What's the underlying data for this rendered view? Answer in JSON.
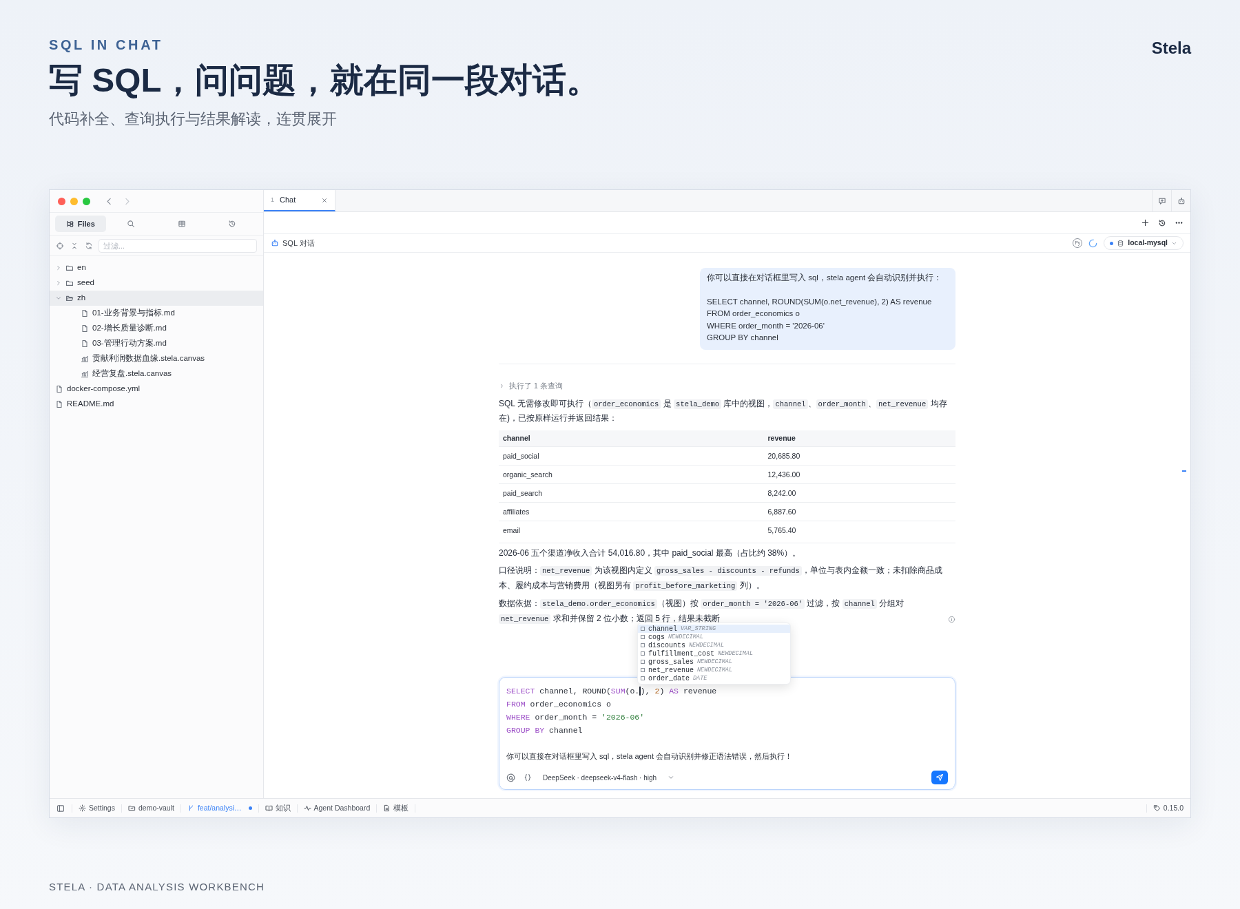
{
  "hero": {
    "eyebrow": "SQL IN CHAT",
    "title": "写 SQL，问问题，就在同一段对话。",
    "subtitle": "代码补全、查询执行与结果解读，连贯展开",
    "brand": "Stela"
  },
  "sidebar": {
    "tabs": [
      {
        "kind": "files",
        "label": "Files",
        "selected": true
      },
      {
        "kind": "search",
        "selected": false
      },
      {
        "kind": "table",
        "selected": false
      },
      {
        "kind": "history",
        "selected": false
      }
    ],
    "filter": {
      "placeholder": "过滤..."
    },
    "tree": [
      {
        "kind": "folder",
        "label": "en",
        "expanded": false,
        "selected": false
      },
      {
        "kind": "folder",
        "label": "seed",
        "expanded": false,
        "selected": false
      },
      {
        "kind": "folder",
        "label": "zh",
        "expanded": true,
        "selected": true,
        "children": [
          {
            "kind": "file",
            "label": "01-业务背景与指标.md",
            "selected": false
          },
          {
            "kind": "file",
            "label": "02-增长质量诊断.md",
            "selected": false
          },
          {
            "kind": "file",
            "label": "03-管理行动方案.md",
            "selected": false
          },
          {
            "kind": "canvas",
            "label": "贡献利润数据血缘.stela.canvas",
            "selected": false
          },
          {
            "kind": "canvas",
            "label": "经营复盘.stela.canvas",
            "selected": false
          }
        ]
      },
      {
        "kind": "file",
        "label": "docker-compose.yml",
        "selected": false
      },
      {
        "kind": "file",
        "label": "README.md",
        "selected": false
      }
    ]
  },
  "tabs": [
    {
      "index": "1",
      "label": "Chat",
      "selected": true
    }
  ],
  "chat": {
    "title": "SQL 对话",
    "runtime_badge": "Py",
    "connection": {
      "label": "local-mysql",
      "connected": true
    },
    "user_message": {
      "intro": "你可以直接在对话框里写入 sql，stela agent 会自动识别并执行：",
      "lines": [
        "SELECT channel, ROUND(SUM(o.net_revenue), 2) AS revenue",
        "FROM order_economics o",
        "WHERE order_month = '2026-06'",
        "GROUP BY channel"
      ]
    },
    "tool_summary": {
      "label": "执行了 1 条查询",
      "expanded": false
    },
    "answer_intro": [
      {
        "kind": "text",
        "text": "SQL 无需修改即可执行（"
      },
      {
        "kind": "code",
        "text": "order_economics"
      },
      {
        "kind": "text",
        "text": " 是 "
      },
      {
        "kind": "code",
        "text": "stela_demo"
      },
      {
        "kind": "text",
        "text": " 库中的视图，"
      },
      {
        "kind": "code",
        "text": "channel"
      },
      {
        "kind": "text",
        "text": "、"
      },
      {
        "kind": "code",
        "text": "order_month"
      },
      {
        "kind": "text",
        "text": "、"
      },
      {
        "kind": "code",
        "text": "net_revenue"
      },
      {
        "kind": "text",
        "text": " 均存在)，已按原样运行并返回结果："
      }
    ],
    "result_table": {
      "columns": [
        "channel",
        "revenue"
      ],
      "rows": [
        [
          "paid_social",
          "20,685.80"
        ],
        [
          "organic_search",
          "12,436.00"
        ],
        [
          "paid_search",
          "8,242.00"
        ],
        [
          "affiliates",
          "6,887.60"
        ],
        [
          "email",
          "5,765.40"
        ]
      ]
    },
    "paragraphs": [
      [
        {
          "kind": "text",
          "text": "2026-06 五个渠道净收入合计 54,016.80，其中 paid_social 最高（占比约 38%）。"
        }
      ],
      [
        {
          "kind": "text",
          "text": "口径说明："
        },
        {
          "kind": "code",
          "text": "net_revenue"
        },
        {
          "kind": "text",
          "text": " 为该视图内定义 "
        },
        {
          "kind": "code",
          "text": "gross_sales - discounts - refunds"
        },
        {
          "kind": "text",
          "text": "，单位与表内金额一致；未扣除商品成本、履约成本与营销费用（视图另有 "
        },
        {
          "kind": "code",
          "text": "profit_before_marketing"
        },
        {
          "kind": "text",
          "text": " 列）。"
        }
      ],
      [
        {
          "kind": "text",
          "text": "数据依据："
        },
        {
          "kind": "code",
          "text": "stela_demo.order_economics"
        },
        {
          "kind": "text",
          "text": "（视图）按 "
        },
        {
          "kind": "code",
          "text": "order_month = '2026-06'"
        },
        {
          "kind": "text",
          "text": " 过滤，按 "
        },
        {
          "kind": "code",
          "text": "channel"
        },
        {
          "kind": "text",
          "text": " 分组对 "
        },
        {
          "kind": "code",
          "text": "net_revenue"
        },
        {
          "kind": "text",
          "text": " 求和并保留 2 位小数；返回 5 行，结果未截断"
        }
      ]
    ],
    "completion": {
      "items": [
        {
          "name": "channel",
          "type": "VAR_STRING",
          "selected": true
        },
        {
          "name": "cogs",
          "type": "NEWDECIMAL",
          "selected": false
        },
        {
          "name": "discounts",
          "type": "NEWDECIMAL",
          "selected": false
        },
        {
          "name": "fulfillment_cost",
          "type": "NEWDECIMAL",
          "selected": false
        },
        {
          "name": "gross_sales",
          "type": "NEWDECIMAL",
          "selected": false
        },
        {
          "name": "net_revenue",
          "type": "NEWDECIMAL",
          "selected": false
        },
        {
          "name": "order_date",
          "type": "DATE",
          "selected": false
        }
      ]
    },
    "composer": {
      "code_lines": [
        [
          {
            "kind": "keyword",
            "text": "SELECT"
          },
          {
            "kind": "plain",
            "text": " channel, ROUND("
          },
          {
            "kind": "keyword",
            "text": "SUM"
          },
          {
            "kind": "plain",
            "text": "(o."
          },
          {
            "kind": "caret"
          },
          {
            "kind": "plain",
            "text": "), "
          },
          {
            "kind": "number",
            "text": "2"
          },
          {
            "kind": "plain",
            "text": ") "
          },
          {
            "kind": "keyword",
            "text": "AS"
          },
          {
            "kind": "plain",
            "text": " revenue"
          }
        ],
        [
          {
            "kind": "keyword",
            "text": "FROM"
          },
          {
            "kind": "plain",
            "text": " order_economics o"
          }
        ],
        [
          {
            "kind": "keyword",
            "text": "WHERE"
          },
          {
            "kind": "plain",
            "text": " order_month = "
          },
          {
            "kind": "string",
            "text": "'2026-06'"
          }
        ],
        [
          {
            "kind": "keyword",
            "text": "GROUP BY"
          },
          {
            "kind": "plain",
            "text": " channel"
          }
        ]
      ],
      "text": "你可以直接在对话框里写入 sql，stela agent 会自动识别并修正语法错误，然后执行！",
      "model": "DeepSeek · deepseek-v4-flash · high"
    }
  },
  "status_bar": {
    "items": [
      {
        "kind": "settings",
        "label": "Settings"
      },
      {
        "kind": "vault",
        "label": "demo-vault"
      },
      {
        "kind": "branch",
        "label": "feat/analysi…",
        "modified": true
      },
      {
        "kind": "knowledge",
        "label": "知识"
      },
      {
        "kind": "activity",
        "label": "Agent Dashboard"
      },
      {
        "kind": "template",
        "label": "模板"
      }
    ],
    "version": "0.15.0"
  },
  "footer": "STELA · DATA ANALYSIS WORKBENCH"
}
